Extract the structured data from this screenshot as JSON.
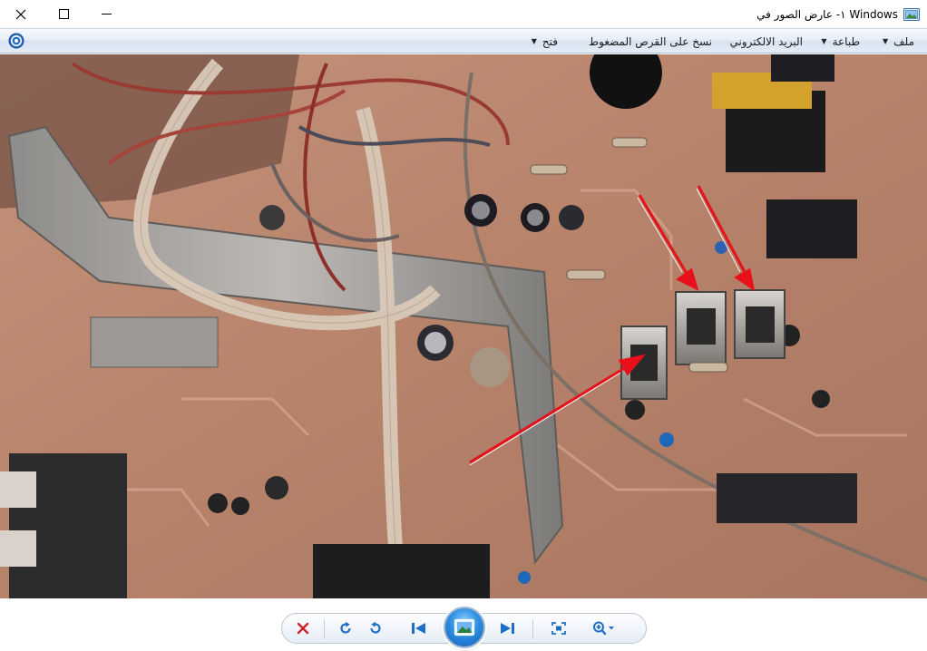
{
  "window": {
    "title": "١- عارض الصور في Windows",
    "controls": {
      "close": "close-icon",
      "maximize": "maximize-icon",
      "minimize": "minimize-icon"
    }
  },
  "menu": {
    "items": [
      {
        "label": "ملف",
        "has_arrow": true
      },
      {
        "label": "طباعة",
        "has_arrow": true
      },
      {
        "label": "البريد الالكتروني",
        "has_arrow": false
      },
      {
        "label": "نسخ على القرص المضغوط",
        "has_arrow": false
      },
      {
        "label": "فتح",
        "has_arrow": true
      }
    ],
    "help_icon": "help-icon"
  },
  "image": {
    "subject": "circuit board photo with red arrows",
    "arrow_color": "#e8101a"
  },
  "toolbar": {
    "buttons": [
      {
        "name": "delete-button",
        "icon": "delete-x-icon"
      },
      {
        "name": "rotate-clockwise-button",
        "icon": "rotate-cw-icon"
      },
      {
        "name": "rotate-counterclockwise-button",
        "icon": "rotate-ccw-icon"
      },
      {
        "name": "previous-button",
        "icon": "previous-icon"
      },
      {
        "name": "slideshow-button",
        "icon": "slideshow-icon"
      },
      {
        "name": "next-button",
        "icon": "next-icon"
      },
      {
        "name": "actual-size-button",
        "icon": "actual-size-icon"
      },
      {
        "name": "zoom-button",
        "icon": "zoom-icon"
      }
    ]
  },
  "colors": {
    "menu_gradient_top": "#f7fafe",
    "menu_gradient_bottom": "#d7e3f2",
    "accent_blue": "#1f6fc8",
    "delete_red": "#d0212b"
  }
}
